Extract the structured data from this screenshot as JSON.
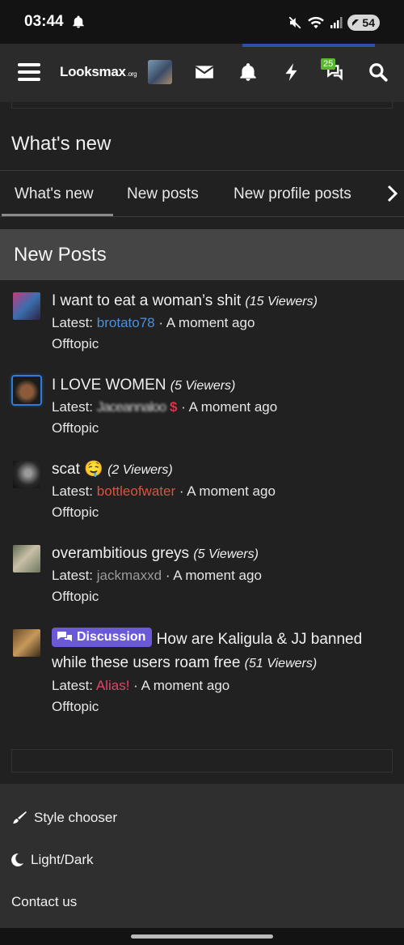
{
  "status_bar": {
    "time": "03:44",
    "battery": "54"
  },
  "header": {
    "logo": "Looksmax",
    "logo_suffix": ".org",
    "alerts_badge": "25"
  },
  "page": {
    "title": "What's new"
  },
  "tabs": [
    {
      "label": "What's new"
    },
    {
      "label": "New posts"
    },
    {
      "label": "New profile posts"
    }
  ],
  "block": {
    "title": "New Posts"
  },
  "threads": [
    {
      "title": "I want to eat a woman’s shit",
      "viewers": "(15 Viewers)",
      "latest_label": "Latest:",
      "user": "brotato78",
      "time": "· A moment ago",
      "forum": "Offtopic"
    },
    {
      "title": "I LOVE WOMEN",
      "viewers": "(5 Viewers)",
      "latest_label": "Latest:",
      "user": "Jaceannaloo",
      "user_suffix": "$",
      "time": "· A moment ago",
      "forum": "Offtopic"
    },
    {
      "title": "scat 🤤",
      "viewers": "(2 Viewers)",
      "latest_label": "Latest:",
      "user": "bottleofwater",
      "time": "· A moment ago",
      "forum": "Offtopic"
    },
    {
      "title": "overambitious greys",
      "viewers": "(5 Viewers)",
      "latest_label": "Latest:",
      "user": "jackmaxxd",
      "time": "· A moment ago",
      "forum": "Offtopic"
    },
    {
      "prefix": "Discussion",
      "title": "How are Kaligula & JJ banned while these users roam free",
      "viewers": "(51 Viewers)",
      "latest_label": "Latest:",
      "user": "Alias!",
      "time": "· A moment ago",
      "forum": "Offtopic"
    }
  ],
  "footer": {
    "style_chooser": "Style chooser",
    "light_dark": "Light/Dark",
    "contact": "Contact us"
  },
  "colors": {
    "accent": "#2d4fa6",
    "discussion_label": "#6a5ad8",
    "badge": "#5cb531"
  }
}
